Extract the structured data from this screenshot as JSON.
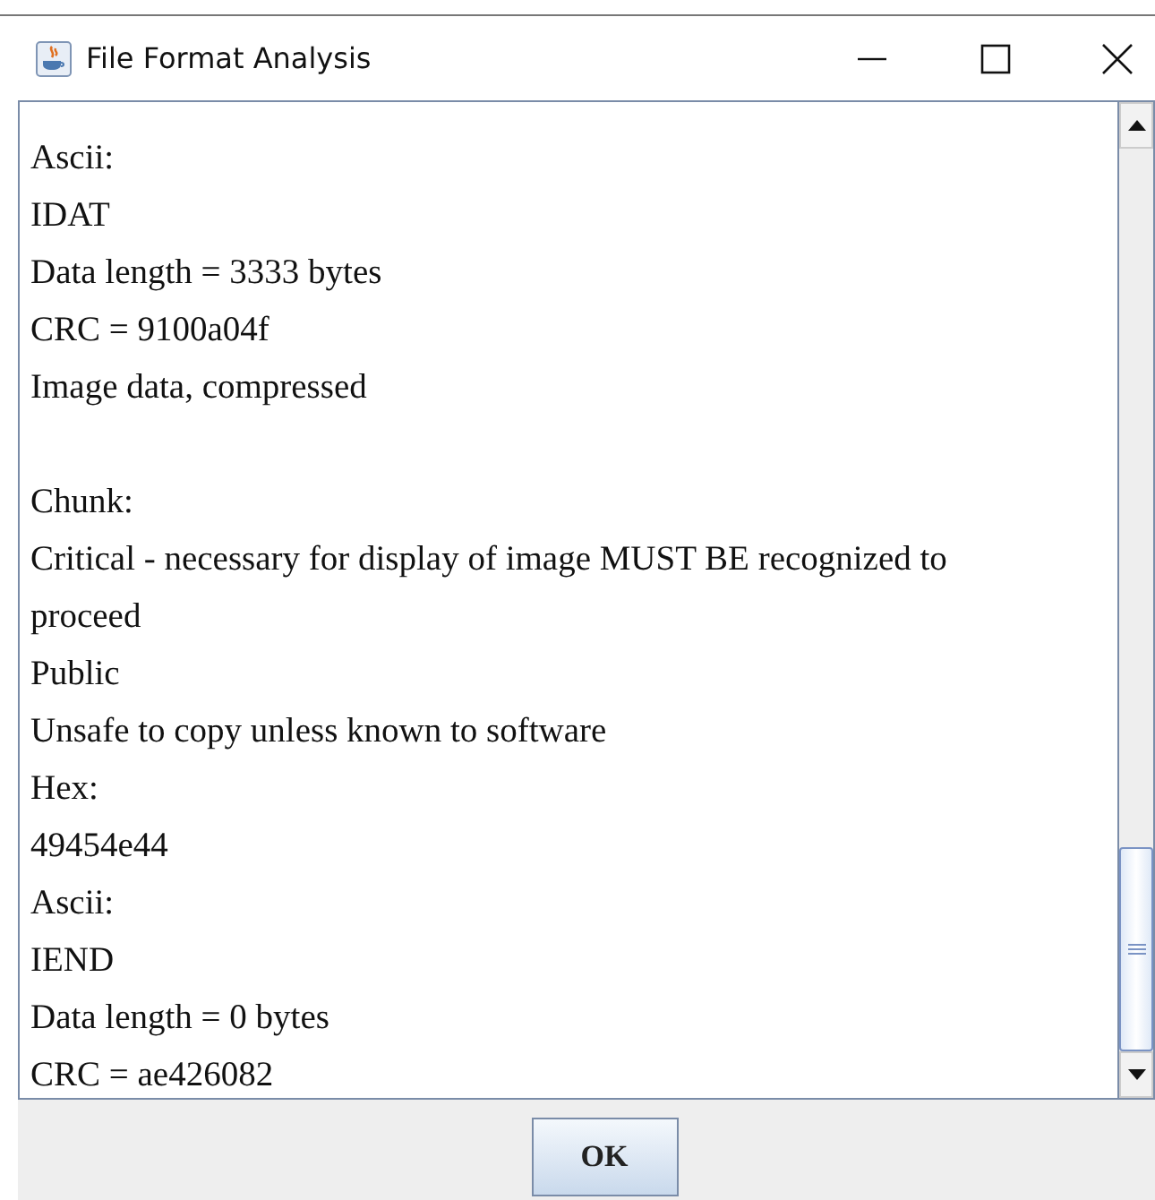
{
  "window": {
    "title": "File Format Analysis"
  },
  "report": {
    "sections": [
      [
        "Ascii:",
        "IDAT",
        "Data length = 3333 bytes",
        "CRC = 9100a04f",
        "Image data, compressed"
      ],
      [
        "Chunk:",
        "Critical - necessary for display of image MUST BE recognized to proceed",
        "Public",
        "Unsafe to copy unless known to software",
        "Hex:",
        "49454e44",
        "Ascii:",
        "IEND",
        "Data length = 0 bytes",
        "CRC = ae426082"
      ]
    ]
  },
  "buttons": [
    {
      "label": "OK"
    }
  ]
}
